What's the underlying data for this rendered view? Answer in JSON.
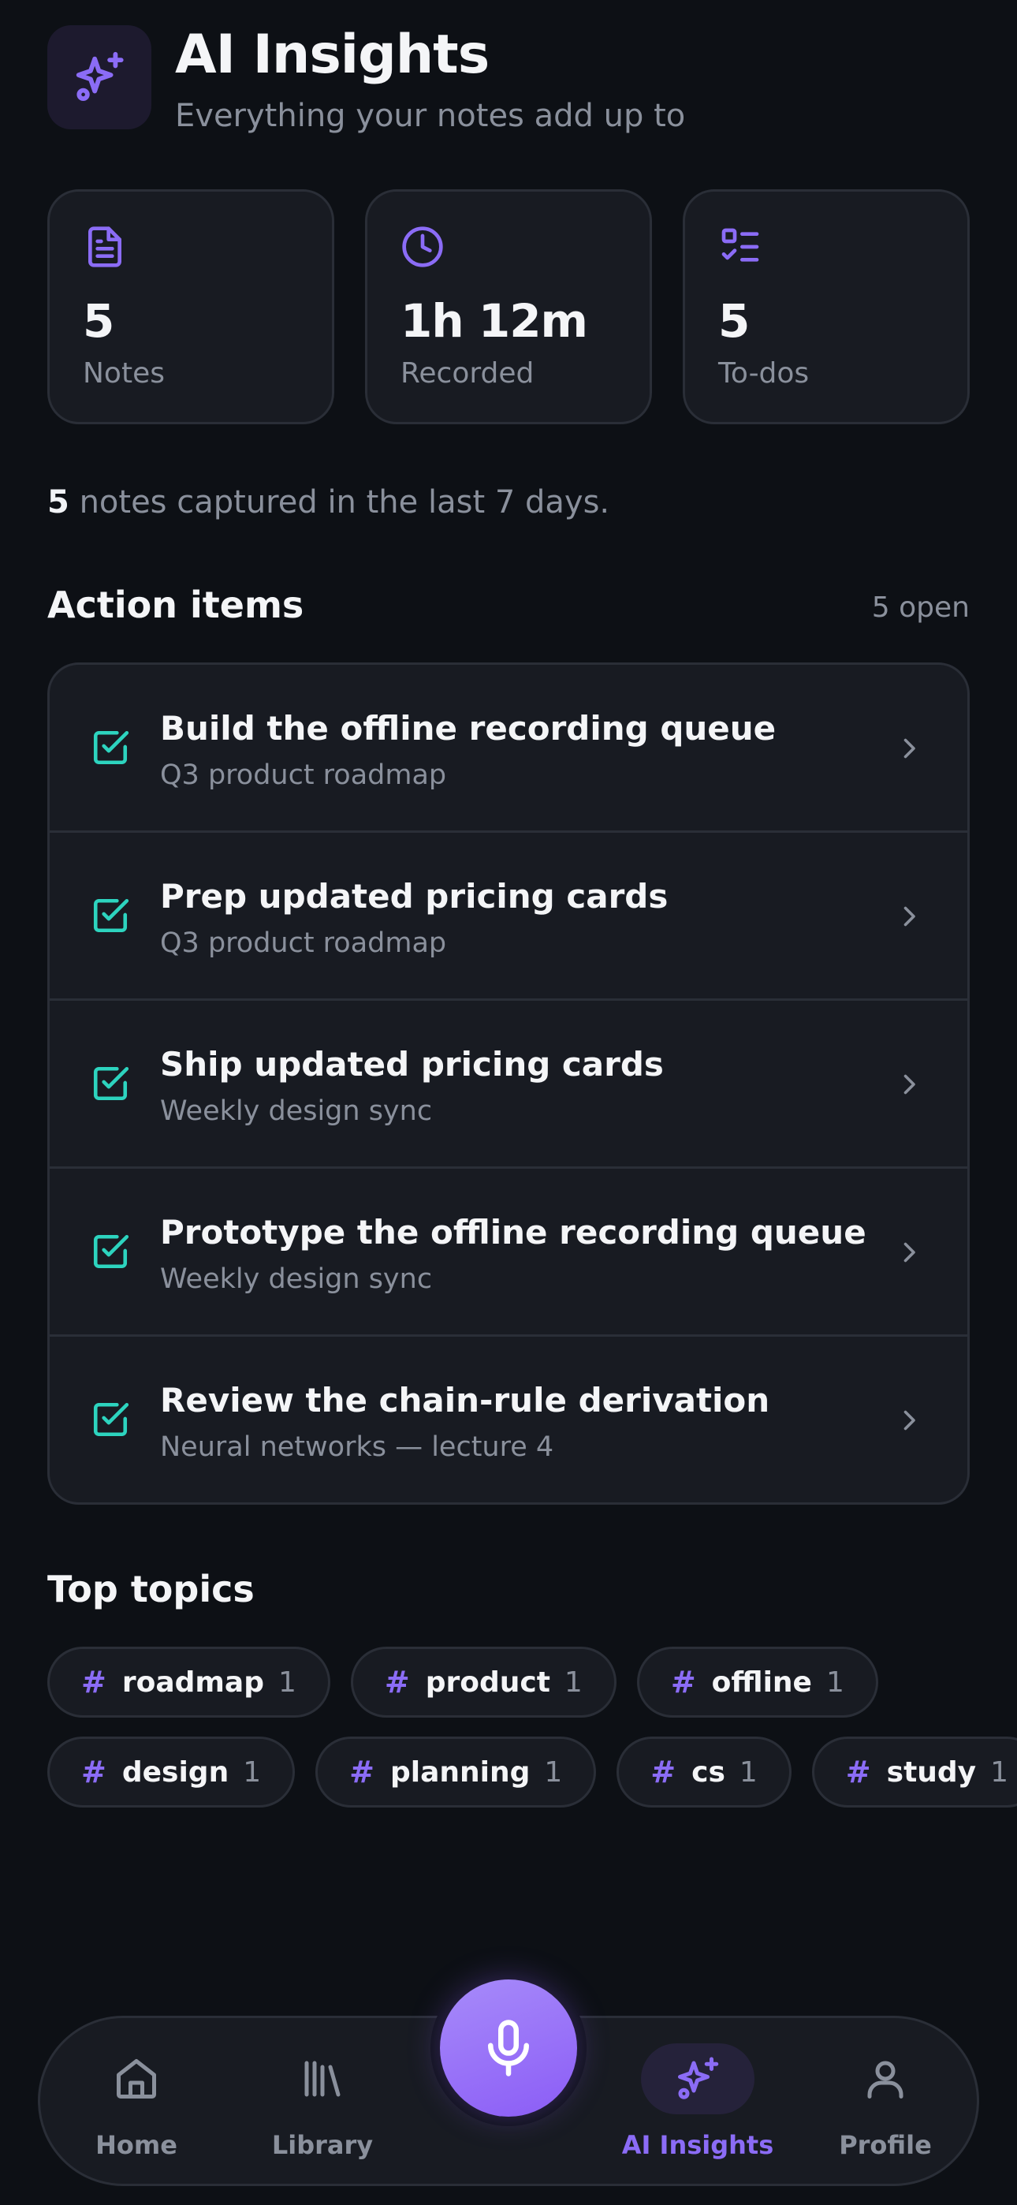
{
  "header": {
    "title": "AI Insights",
    "subtitle": "Everything your notes add up to",
    "icon": "sparkles-icon"
  },
  "stats": [
    {
      "icon": "document-icon",
      "value": "5",
      "label": "Notes"
    },
    {
      "icon": "clock-icon",
      "value": "1h 12m",
      "label": "Recorded"
    },
    {
      "icon": "checklist-icon",
      "value": "5",
      "label": "To-dos"
    }
  ],
  "summary": {
    "count": "5",
    "text": "notes captured in the last 7 days."
  },
  "action_items": {
    "title": "Action items",
    "open_count": "5 open",
    "items": [
      {
        "title": "Build the offline recording queue",
        "source": "Q3 product roadmap"
      },
      {
        "title": "Prep updated pricing cards",
        "source": "Q3 product roadmap"
      },
      {
        "title": "Ship updated pricing cards",
        "source": "Weekly design sync"
      },
      {
        "title": "Prototype the offline recording queue",
        "source": "Weekly design sync"
      },
      {
        "title": "Review the chain-rule derivation",
        "source": "Neural networks — lecture 4"
      }
    ]
  },
  "topics": {
    "title": "Top topics",
    "rows": [
      [
        {
          "name": "roadmap",
          "count": "1"
        },
        {
          "name": "product",
          "count": "1"
        },
        {
          "name": "offline",
          "count": "1"
        }
      ],
      [
        {
          "name": "design",
          "count": "1"
        },
        {
          "name": "planning",
          "count": "1"
        },
        {
          "name": "cs",
          "count": "1"
        },
        {
          "name": "study",
          "count": "1"
        }
      ]
    ]
  },
  "nav": {
    "items": [
      {
        "label": "Home",
        "icon": "home-icon",
        "active": false
      },
      {
        "label": "Library",
        "icon": "library-icon",
        "active": false
      },
      {
        "label": "AI Insights",
        "icon": "sparkles-icon",
        "active": true
      },
      {
        "label": "Profile",
        "icon": "profile-icon",
        "active": false
      }
    ],
    "record_icon": "microphone-icon"
  },
  "colors": {
    "background": "#0d1015",
    "card": "#181b22",
    "accent": "#8b6cf6",
    "check": "#2dd4bf",
    "muted": "#8a909c"
  }
}
